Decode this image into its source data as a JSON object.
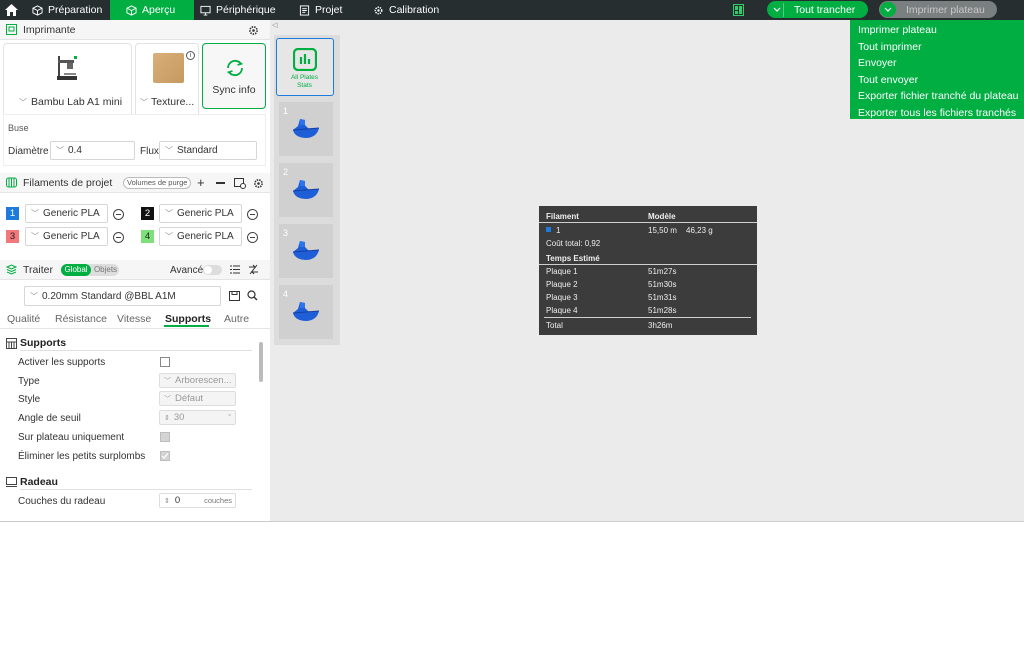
{
  "topbar": {
    "tabs": [
      {
        "label": "Préparation",
        "icon": "cube-icon"
      },
      {
        "label": "Aperçu",
        "icon": "cube-icon"
      },
      {
        "label": "Périphérique",
        "icon": "monitor-icon"
      },
      {
        "label": "Projet",
        "icon": "document-icon"
      },
      {
        "label": "Calibration",
        "icon": "gear-icon"
      }
    ],
    "slice_all_label": "Tout trancher",
    "print_plate_label": "Imprimer plateau",
    "accent": "#00ae42",
    "bar_color": "#262e30"
  },
  "print_menu": {
    "items": [
      "Imprimer plateau",
      "Tout imprimer",
      "Envoyer",
      "Tout envoyer",
      "Exporter fichier tranché du plateau",
      "Exporter tous les fichiers tranchés"
    ]
  },
  "printer": {
    "header": "Imprimante",
    "model": "Bambu Lab A1 mini",
    "plate": "Texture...",
    "sync_label": "Sync info",
    "nozzle_label": "Buse",
    "diameter_label": "Diamètre",
    "diameter_value": "0.4",
    "flow_label": "Flux",
    "flow_value": "Standard"
  },
  "filaments": {
    "header": "Filaments de projet",
    "purge_label": "Volumes de purge",
    "items": [
      {
        "num": "1",
        "name": "Generic PLA",
        "color": "#1e7bde",
        "text": "#ffffff"
      },
      {
        "num": "2",
        "name": "Generic PLA",
        "color": "#111111",
        "text": "#ffffff"
      },
      {
        "num": "3",
        "name": "Generic PLA",
        "color": "#f2787c",
        "text": "#222222"
      },
      {
        "num": "4",
        "name": "Generic PLA",
        "color": "#7de07a",
        "text": "#222222"
      }
    ]
  },
  "process": {
    "header": "Traiter",
    "global_label": "Global",
    "objects_label": "Objets",
    "advanced_label": "Avancé",
    "profile": "0.20mm Standard @BBL A1M",
    "tabs": [
      "Qualité",
      "Résistance",
      "Vitesse",
      "Supports",
      "Autre"
    ],
    "active_tab": "Supports",
    "supports_section": "Supports",
    "rows": [
      {
        "label": "Activer les supports",
        "value": ""
      },
      {
        "label": "Type",
        "value": "Arborescen..."
      },
      {
        "label": "Style",
        "value": "Défaut"
      },
      {
        "label": "Angle de seuil",
        "value": "30"
      },
      {
        "label": "Sur plateau uniquement",
        "value": ""
      },
      {
        "label": "Éliminer les petits surplombs",
        "value": ""
      }
    ],
    "raft_section": "Radeau",
    "raft_row_label": "Couches du radeau",
    "raft_value": "0",
    "raft_unit": "couches"
  },
  "plates": {
    "all_stats_line1": "All Plates",
    "all_stats_line2": "Stats",
    "numbers": [
      "1",
      "2",
      "3",
      "4"
    ]
  },
  "stats": {
    "col_filament": "Filament",
    "col_model": "Modèle",
    "filament_id": "1",
    "filament_length": "15,50 m",
    "filament_weight": "46,23 g",
    "cost": "Coût total: 0,92",
    "time_header": "Temps Estimé",
    "plates": [
      {
        "name": "Plaque 1",
        "time": "51m27s"
      },
      {
        "name": "Plaque 2",
        "time": "51m30s"
      },
      {
        "name": "Plaque 3",
        "time": "51m31s"
      },
      {
        "name": "Plaque 4",
        "time": "51m28s"
      }
    ],
    "total_label": "Total",
    "total_time": "3h26m",
    "filament_color": "#1e7bde"
  }
}
